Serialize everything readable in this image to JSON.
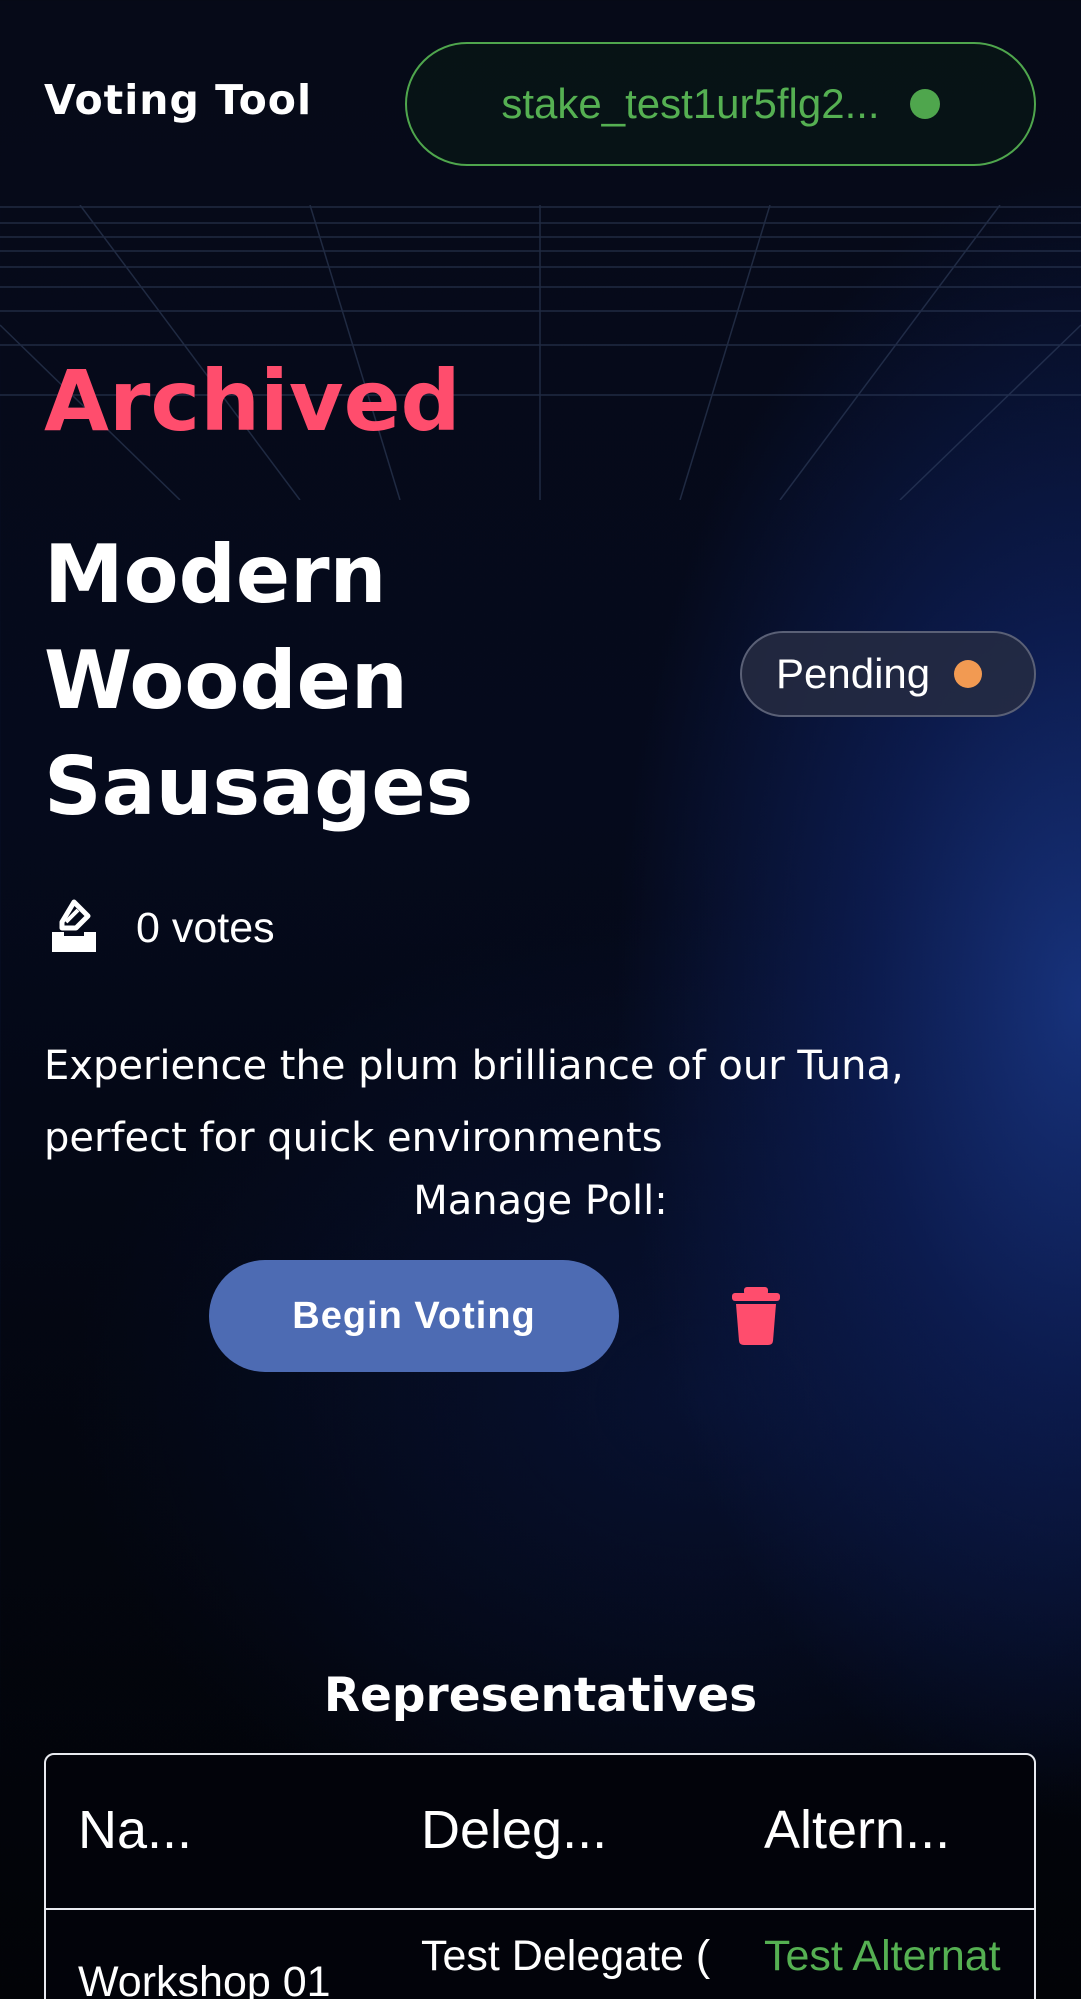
{
  "header": {
    "app_title": "Voting Tool",
    "wallet_address": "stake_test1ur5flg2...",
    "wallet_status_color": "#4fa64d"
  },
  "poll": {
    "state_label": "Archived",
    "title": "Modern Wooden Sausages",
    "status": "Pending",
    "status_color": "#f29a52",
    "votes_icon": "ballot-box-icon",
    "votes": "0 votes",
    "description": "Experience the plum brilliance of our Tuna, perfect for quick environments"
  },
  "manage": {
    "label": "Manage Poll:",
    "begin_button": "Begin Voting",
    "delete_icon": "trash-icon"
  },
  "representatives": {
    "title": "Representatives",
    "columns": [
      "Na...",
      "Deleg...",
      "Altern..."
    ],
    "rows": [
      {
        "name": "Workshop 01",
        "delegate": "Test Delegate (",
        "alternate": "Test Alternat"
      }
    ]
  },
  "colors": {
    "accent_red": "#ff4d6d",
    "button_blue": "#4d6bb3",
    "green": "#55b052"
  }
}
